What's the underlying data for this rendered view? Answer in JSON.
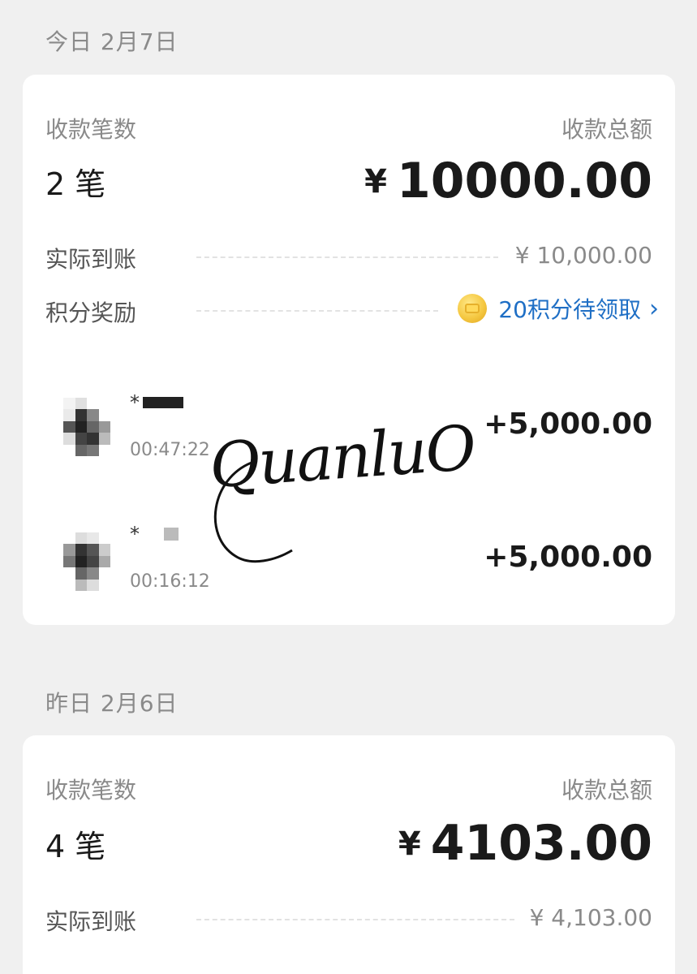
{
  "sections": [
    {
      "date": "今日 2月7日",
      "count_label": "收款笔数",
      "count": "2 笔",
      "total_label": "收款总额",
      "total_currency": "¥",
      "total_amount": "10000.00",
      "received_label": "实际到账",
      "received_value": "¥ 10,000.00",
      "points_label": "积分奖励",
      "points_value": "20积分待领取",
      "transactions": [
        {
          "name_prefix": "*",
          "time": "00:47:22",
          "amount": "+5,000.00"
        },
        {
          "name_prefix": "*",
          "time": "00:16:12",
          "amount": "+5,000.00"
        }
      ]
    },
    {
      "date": "昨日 2月6日",
      "count_label": "收款笔数",
      "count": "4 笔",
      "total_label": "收款总额",
      "total_currency": "¥",
      "total_amount": "4103.00",
      "received_label": "实际到账",
      "received_value": "¥ 4,103.00"
    }
  ],
  "watermark": "QuanluO",
  "icons": {
    "coin": "gold-coin-icon",
    "chevron": "chevron-right-icon"
  },
  "colors": {
    "link_blue": "#1f6fc5",
    "background": "#f0f0f0",
    "card": "#ffffff"
  }
}
